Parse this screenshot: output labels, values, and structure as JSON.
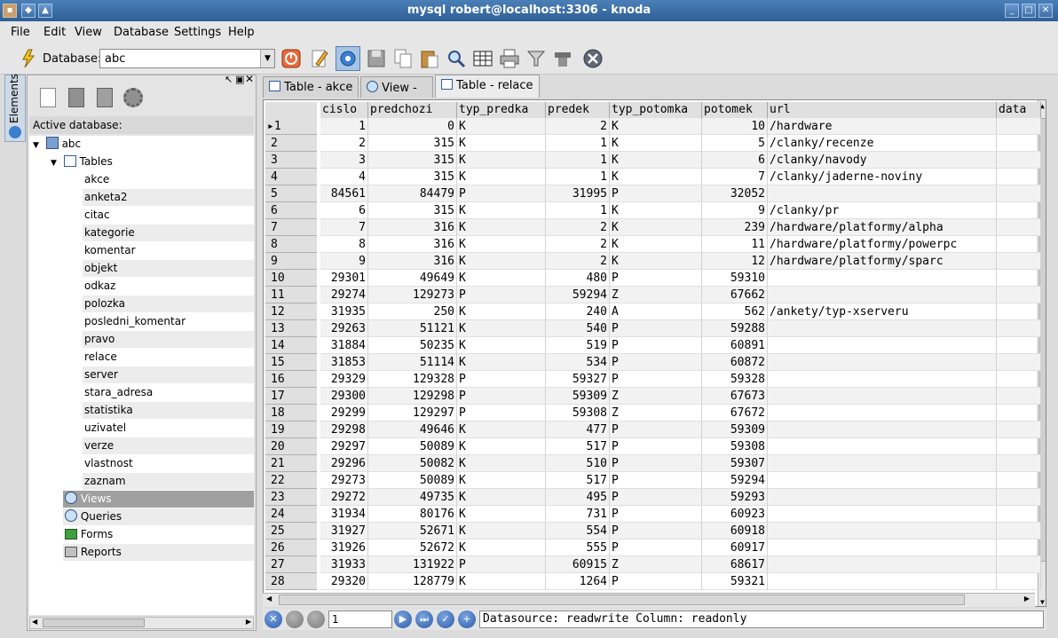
{
  "window": {
    "title": "mysql robert@localhost:3306 - knoda"
  },
  "menu": [
    "File",
    "Edit",
    "View",
    "Database",
    "Settings",
    "Help"
  ],
  "toolbar": {
    "database_label": "Database:",
    "database_value": "abc"
  },
  "side_tab": {
    "label": "Elements"
  },
  "left_panel": {
    "active_db_label": "Active database:",
    "db_name": "abc",
    "tables_label": "Tables",
    "tables": [
      "akce",
      "anketa2",
      "citac",
      "kategorie",
      "komentar",
      "objekt",
      "odkaz",
      "polozka",
      "posledni_komentar",
      "pravo",
      "relace",
      "server",
      "stara_adresa",
      "statistika",
      "uzivatel",
      "verze",
      "vlastnost",
      "zaznam"
    ],
    "categories": [
      "Views",
      "Queries",
      "Forms",
      "Reports"
    ]
  },
  "tabs": [
    {
      "label": "Table - akce"
    },
    {
      "label": "View -"
    },
    {
      "label": "Table - relace"
    }
  ],
  "grid": {
    "columns": [
      "cislo",
      "predchozi",
      "typ_predka",
      "predek",
      "typ_potomka",
      "potomek",
      "url",
      "data"
    ],
    "rows": [
      [
        "1",
        "1",
        "0",
        "K",
        "2",
        "K",
        "10",
        "/hardware"
      ],
      [
        "2",
        "2",
        "315",
        "K",
        "1",
        "K",
        "5",
        "/clanky/recenze"
      ],
      [
        "3",
        "3",
        "315",
        "K",
        "1",
        "K",
        "6",
        "/clanky/navody"
      ],
      [
        "4",
        "4",
        "315",
        "K",
        "1",
        "K",
        "7",
        "/clanky/jaderne-noviny"
      ],
      [
        "5",
        "84561",
        "84479",
        "P",
        "31995",
        "P",
        "32052",
        ""
      ],
      [
        "6",
        "6",
        "315",
        "K",
        "1",
        "K",
        "9",
        "/clanky/pr"
      ],
      [
        "7",
        "7",
        "316",
        "K",
        "2",
        "K",
        "239",
        "/hardware/platformy/alpha"
      ],
      [
        "8",
        "8",
        "316",
        "K",
        "2",
        "K",
        "11",
        "/hardware/platformy/powerpc"
      ],
      [
        "9",
        "9",
        "316",
        "K",
        "2",
        "K",
        "12",
        "/hardware/platformy/sparc"
      ],
      [
        "10",
        "29301",
        "49649",
        "K",
        "480",
        "P",
        "59310",
        ""
      ],
      [
        "11",
        "29274",
        "129273",
        "P",
        "59294",
        "Z",
        "67662",
        ""
      ],
      [
        "12",
        "31935",
        "250",
        "K",
        "240",
        "A",
        "562",
        "/ankety/typ-xserveru"
      ],
      [
        "13",
        "29263",
        "51121",
        "K",
        "540",
        "P",
        "59288",
        ""
      ],
      [
        "14",
        "31884",
        "50235",
        "K",
        "519",
        "P",
        "60891",
        ""
      ],
      [
        "15",
        "31853",
        "51114",
        "K",
        "534",
        "P",
        "60872",
        ""
      ],
      [
        "16",
        "29329",
        "129328",
        "P",
        "59327",
        "P",
        "59328",
        ""
      ],
      [
        "17",
        "29300",
        "129298",
        "P",
        "59309",
        "Z",
        "67673",
        ""
      ],
      [
        "18",
        "29299",
        "129297",
        "P",
        "59308",
        "Z",
        "67672",
        ""
      ],
      [
        "19",
        "29298",
        "49646",
        "K",
        "477",
        "P",
        "59309",
        ""
      ],
      [
        "20",
        "29297",
        "50089",
        "K",
        "517",
        "P",
        "59308",
        ""
      ],
      [
        "21",
        "29296",
        "50082",
        "K",
        "510",
        "P",
        "59307",
        ""
      ],
      [
        "22",
        "29273",
        "50089",
        "K",
        "517",
        "P",
        "59294",
        ""
      ],
      [
        "23",
        "29272",
        "49735",
        "K",
        "495",
        "P",
        "59293",
        ""
      ],
      [
        "24",
        "31934",
        "80176",
        "K",
        "731",
        "P",
        "60923",
        ""
      ],
      [
        "25",
        "31927",
        "52671",
        "K",
        "554",
        "P",
        "60918",
        ""
      ],
      [
        "26",
        "31926",
        "52672",
        "K",
        "555",
        "P",
        "60917",
        ""
      ],
      [
        "27",
        "31933",
        "131922",
        "P",
        "60915",
        "Z",
        "68617",
        ""
      ],
      [
        "28",
        "29320",
        "128779",
        "K",
        "1264",
        "P",
        "59321",
        ""
      ]
    ]
  },
  "navigator": {
    "record": "1",
    "status": "Datasource: readwrite Column: readonly"
  }
}
